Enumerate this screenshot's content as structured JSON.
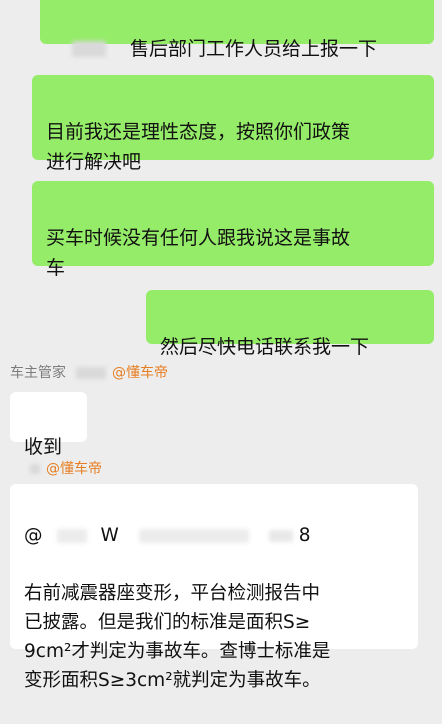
{
  "messages": [
    {
      "side": "right",
      "text": "售后部门工作人员给上报一下"
    },
    {
      "side": "right",
      "text": "目前我还是理性态度，按照你们政策\n进行解决吧"
    },
    {
      "side": "right",
      "text": "买车时候没有任何人跟我说这是事故\n车"
    },
    {
      "side": "right",
      "text": "然后尽快电话联系我一下"
    }
  ],
  "reply1": {
    "sender": "车主管家",
    "mention": "@懂车帝",
    "text": "收到"
  },
  "reply2": {
    "mention": "@懂车帝",
    "at_prefix": "@",
    "at_w": "W",
    "at_suffix": "8",
    "text": "右前减震器座变形，平台检测报告中\n已披露。但是我们的标准是面积S≥\n9cm²才判定为事故车。查博士标准是\n变形面积S≥3cm²就判定为事故车。"
  },
  "colors": {
    "sent": "#95ec69",
    "received": "#ffffff",
    "background": "#ededed",
    "mention": "#e67e22"
  }
}
